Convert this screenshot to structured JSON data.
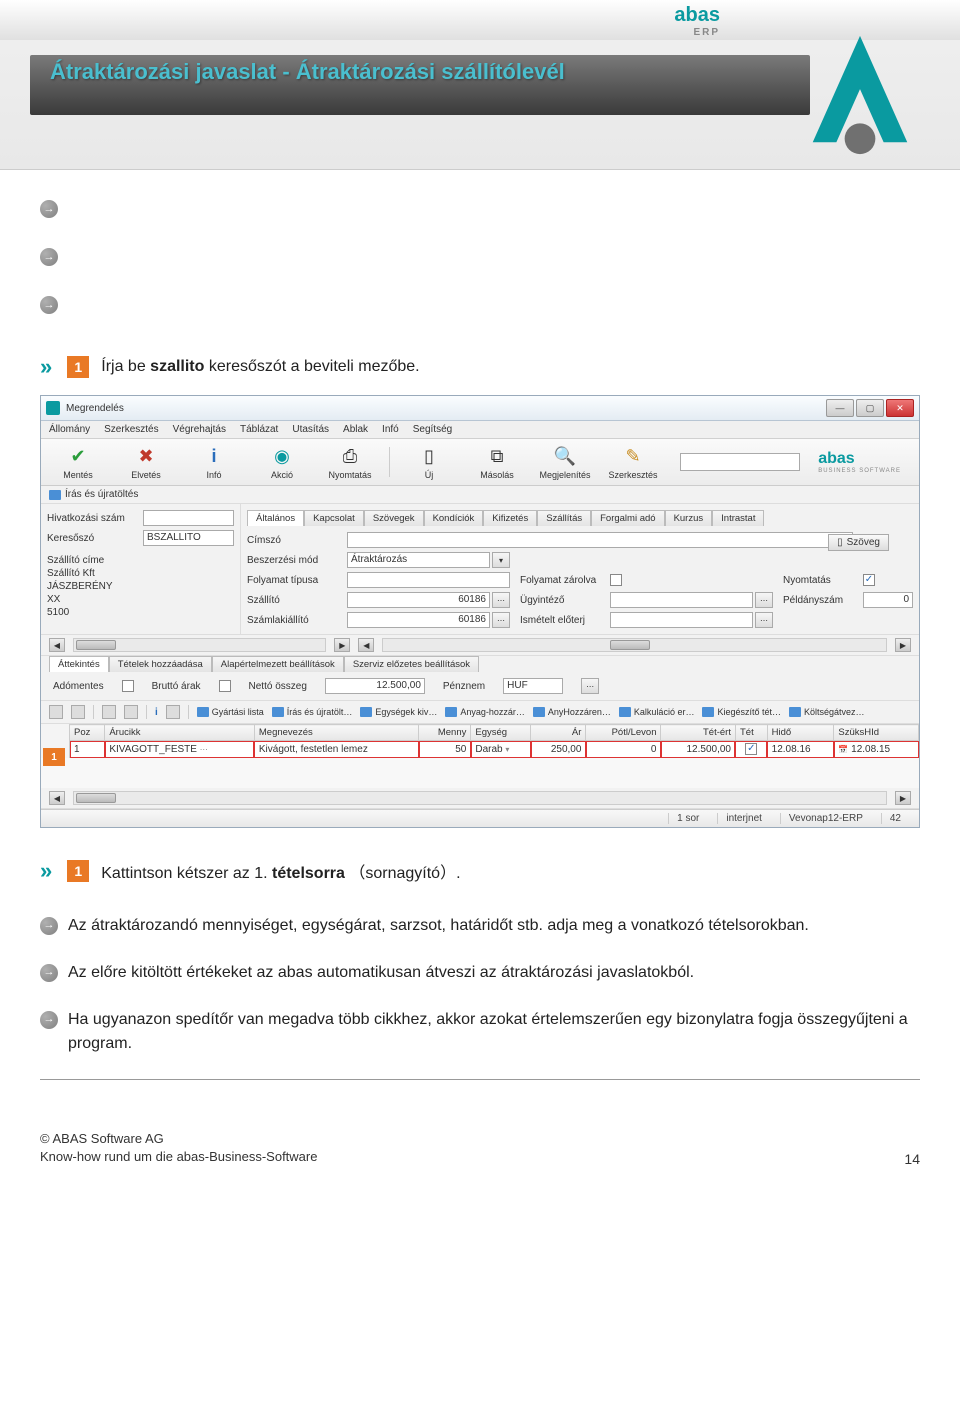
{
  "header": {
    "brand_a": "abas",
    "brand_erp": "ERP",
    "title": "Átraktározási javaslat    - Átraktározási szállítólevél"
  },
  "step1": {
    "prefix": "Írja be ",
    "bold": "szallito",
    "suffix": " keresőszót a beviteli mezőbe."
  },
  "window": {
    "title": "Megrendelés",
    "menubar": [
      "Állomány",
      "Szerkesztés",
      "Végrehajtás",
      "Táblázat",
      "Utasítás",
      "Ablak",
      "Infó",
      "Segítség"
    ],
    "toolbar": [
      {
        "label": "Mentés",
        "icon": "✔",
        "color": "#2a9d3b"
      },
      {
        "label": "Elvetés",
        "icon": "✖",
        "color": "#c0392b"
      },
      {
        "label": "Infó",
        "icon": "i",
        "color": "#2a6dbb"
      },
      {
        "label": "Akció",
        "icon": "◉",
        "color": "#0a9aa0"
      },
      {
        "label": "Nyomtatás",
        "icon": "⎙",
        "color": "#888"
      },
      {
        "label": "Új",
        "icon": "▯",
        "color": "#888"
      },
      {
        "label": "Másolás",
        "icon": "⧉",
        "color": "#888"
      },
      {
        "label": "Megjelenítés",
        "icon": "🔍",
        "color": "#888"
      },
      {
        "label": "Szerkesztés",
        "icon": "✎",
        "color": "#c78b1e"
      }
    ],
    "brand": "abas",
    "brand_sub": "BUSINESS SOFTWARE",
    "sub_toolbar": "Írás és újratöltés",
    "left": {
      "ref_label": "Hivatkozási szám",
      "search_label": "Keresőszó",
      "search_value": "BSZALLITO",
      "addr_label": "Szállító címe",
      "addr_lines": [
        "Szállító Kft",
        "JÁSZBERÉNY",
        "XX",
        "5100"
      ]
    },
    "tabs": [
      "Általános",
      "Kapcsolat",
      "Szövegek",
      "Kondíciók",
      "Kifizetés",
      "Szállítás",
      "Forgalmi adó",
      "Kurzus",
      "Intrastat"
    ],
    "form": {
      "cimszo": "Címszó",
      "beszerzesi": "Beszerzési mód",
      "beszerzesi_val": "Átraktározás",
      "folyamat_tipus": "Folyamat típusa",
      "szallito": "Szállító",
      "szallito_val": "60186",
      "szamlakiallito": "Számlakiállító",
      "szamlakiallito_val": "60186",
      "folyamat_zarolva": "Folyamat zárolva",
      "ugyintezo": "Ügyintéző",
      "ismetelt": "Ismételt előterj",
      "nyomtatas": "Nyomtatás",
      "peldanyszam": "Példányszám",
      "peldanyszam_val": "0",
      "szoveg_btn": "Szöveg"
    },
    "middle_tabs": [
      "Áttekintés",
      "Tételek hozzáadása",
      "Alapértelmezett beállítások",
      "Szerviz előzetes beállítások"
    ],
    "summary": {
      "adomentes": "Adómentes",
      "brutto": "Bruttó árak",
      "netto": "Nettó összeg",
      "netto_val": "12.500,00",
      "penznem": "Pénznem",
      "penznem_val": "HUF"
    },
    "folders": [
      "Gyártási lista",
      "Írás és újratölt…",
      "Egységek kiv…",
      "Anyag-hozzár…",
      "AnyHozzáren…",
      "Kalkuláció er…",
      "Kiegészítő tét…",
      "Költségátvez…"
    ],
    "grid": {
      "headers": [
        "Poz",
        "Árucikk",
        "Megnevezés",
        "Menny",
        "Egység",
        "Ár",
        "Pótl/Levon",
        "Tét-ért",
        "Tét",
        "Hidő",
        "SzüksHId"
      ],
      "row": {
        "poz": "1",
        "arucikk": "KIVAGOTT_FESTE",
        "megnevezes": "Kivágott, festetlen lemez",
        "menny": "50",
        "egyseg": "Darab",
        "ar": "250,00",
        "potl": "0",
        "tetert": "12.500,00",
        "tet": "✓",
        "hido": "12.08.16",
        "szukshid": "12.08.15"
      }
    },
    "status": {
      "sor": "1 sor",
      "net": "interjnet",
      "env": "Vevonap12-ERP",
      "num": "42"
    }
  },
  "step2": {
    "text1": "Kattintson kétszer az 1. ",
    "bold": "tételsorra",
    "text2": " （sornagyító）."
  },
  "notes": [
    "Az átraktározandó mennyiséget, egységárat, sarzsot, határidőt stb. adja meg a vonatkozó tételsorokban.",
    "Az előre kitöltött értékeket az abas automatikusan átveszi az átraktározási javaslatokból.",
    "Ha ugyanazon spedítőr van megadva több cikkhez, akkor azokat értelemszerűen egy bizonylatra fogja összegyűjteni a program."
  ],
  "footer": {
    "line1": "© ABAS Software AG",
    "line2": "Know-how rund um die abas-Business-Software",
    "page": "14"
  }
}
